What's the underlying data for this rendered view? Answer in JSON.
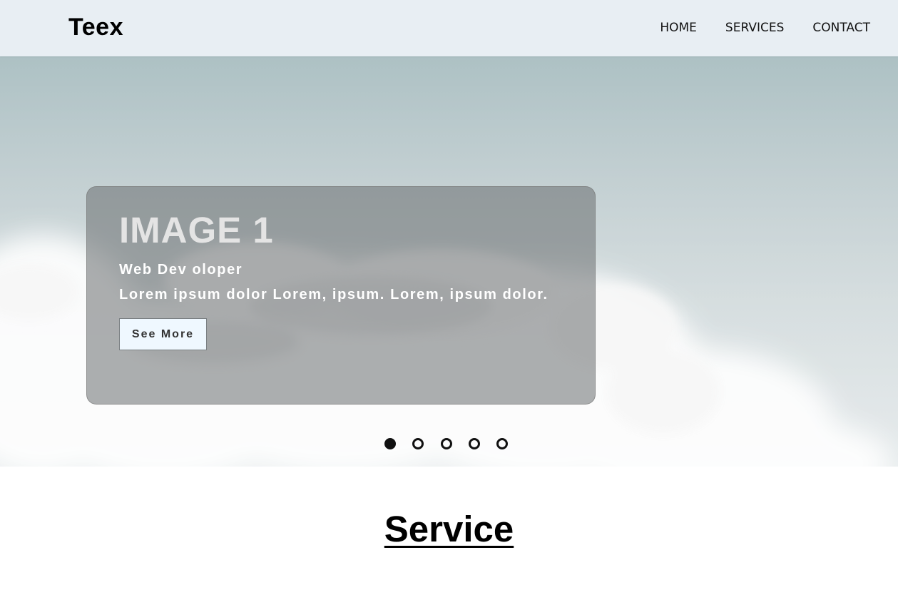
{
  "navbar": {
    "brand": "Teex",
    "links": [
      {
        "label": "HOME"
      },
      {
        "label": "SERVICES"
      },
      {
        "label": "CONTACT"
      }
    ]
  },
  "hero": {
    "slide": {
      "title": "IMAGE 1",
      "subtitle": "Web Dev oloper",
      "text": "Lorem ipsum dolor Lorem, ipsum. Lorem, ipsum dolor.",
      "button_label": "See More"
    },
    "pagination": {
      "total": 5,
      "active_index": 0
    }
  },
  "service_section": {
    "title": "Service"
  },
  "colors": {
    "navbar_bg": "#e8eef3",
    "button_bg": "#eff8ff",
    "dot": "#111111"
  }
}
